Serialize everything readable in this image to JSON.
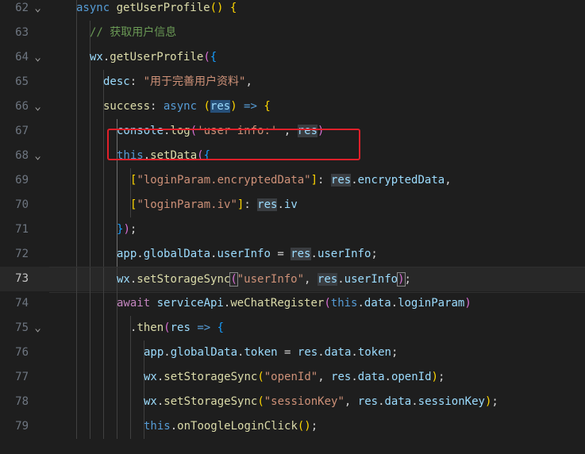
{
  "editor": {
    "lines": [
      {
        "num": "62",
        "fold": "⌄",
        "current": false,
        "indent": 1,
        "tokens": [
          {
            "t": "async ",
            "c": "kw"
          },
          {
            "t": "getUserProfile",
            "c": "fn"
          },
          {
            "t": "() ",
            "c": "br1"
          },
          {
            "t": "{",
            "c": "br1"
          }
        ]
      },
      {
        "num": "63",
        "fold": "",
        "current": false,
        "indent": 2,
        "tokens": [
          {
            "t": "// 获取用户信息",
            "c": "cmt"
          }
        ]
      },
      {
        "num": "64",
        "fold": "⌄",
        "current": false,
        "indent": 2,
        "tokens": [
          {
            "t": "wx",
            "c": "var"
          },
          {
            "t": ".",
            "c": "plain"
          },
          {
            "t": "getUserProfile",
            "c": "fn"
          },
          {
            "t": "(",
            "c": "br2"
          },
          {
            "t": "{",
            "c": "br3"
          }
        ]
      },
      {
        "num": "65",
        "fold": "",
        "current": false,
        "indent": 3,
        "tokens": [
          {
            "t": "desc",
            "c": "var"
          },
          {
            "t": ": ",
            "c": "plain"
          },
          {
            "t": "\"用于完善用户资料\"",
            "c": "str"
          },
          {
            "t": ",",
            "c": "plain"
          }
        ]
      },
      {
        "num": "66",
        "fold": "⌄",
        "current": false,
        "indent": 3,
        "tokens": [
          {
            "t": "success",
            "c": "fn"
          },
          {
            "t": ": ",
            "c": "plain"
          },
          {
            "t": "async ",
            "c": "kw"
          },
          {
            "t": "(",
            "c": "br1"
          },
          {
            "t": "res",
            "c": "var",
            "hl": "hl-dark"
          },
          {
            "t": ")",
            "c": "br1"
          },
          {
            "t": " => ",
            "c": "kw"
          },
          {
            "t": "{",
            "c": "br1"
          }
        ]
      },
      {
        "num": "67",
        "fold": "",
        "current": false,
        "indent": 4,
        "tokens": [
          {
            "t": "console",
            "c": "var"
          },
          {
            "t": ".",
            "c": "plain"
          },
          {
            "t": "log",
            "c": "fn"
          },
          {
            "t": "(",
            "c": "br2"
          },
          {
            "t": "'user info:'",
            "c": "str"
          },
          {
            "t": " , ",
            "c": "plain"
          },
          {
            "t": "res",
            "c": "var",
            "hl": "hl"
          },
          {
            "t": ")",
            "c": "br2"
          }
        ]
      },
      {
        "num": "68",
        "fold": "⌄",
        "current": false,
        "indent": 4,
        "tokens": [
          {
            "t": "this",
            "c": "kw"
          },
          {
            "t": ".",
            "c": "plain"
          },
          {
            "t": "setData",
            "c": "fn"
          },
          {
            "t": "(",
            "c": "br2"
          },
          {
            "t": "{",
            "c": "br3"
          }
        ]
      },
      {
        "num": "69",
        "fold": "",
        "current": false,
        "indent": 5,
        "tokens": [
          {
            "t": "[",
            "c": "br1"
          },
          {
            "t": "\"loginParam.encryptedData\"",
            "c": "str"
          },
          {
            "t": "]",
            "c": "br1"
          },
          {
            "t": ": ",
            "c": "plain"
          },
          {
            "t": "res",
            "c": "var",
            "hl": "hl"
          },
          {
            "t": ".",
            "c": "plain"
          },
          {
            "t": "encryptedData",
            "c": "var"
          },
          {
            "t": ",",
            "c": "plain"
          }
        ]
      },
      {
        "num": "70",
        "fold": "",
        "current": false,
        "indent": 5,
        "tokens": [
          {
            "t": "[",
            "c": "br1"
          },
          {
            "t": "\"loginParam.iv\"",
            "c": "str"
          },
          {
            "t": "]",
            "c": "br1"
          },
          {
            "t": ": ",
            "c": "plain"
          },
          {
            "t": "res",
            "c": "var",
            "hl": "hl"
          },
          {
            "t": ".",
            "c": "plain"
          },
          {
            "t": "iv",
            "c": "var"
          }
        ]
      },
      {
        "num": "71",
        "fold": "",
        "current": false,
        "indent": 4,
        "tokens": [
          {
            "t": "}",
            "c": "br3"
          },
          {
            "t": ")",
            "c": "br2"
          },
          {
            "t": ";",
            "c": "plain"
          }
        ]
      },
      {
        "num": "72",
        "fold": "",
        "current": false,
        "indent": 4,
        "tokens": [
          {
            "t": "app",
            "c": "var"
          },
          {
            "t": ".",
            "c": "plain"
          },
          {
            "t": "globalData",
            "c": "var"
          },
          {
            "t": ".",
            "c": "plain"
          },
          {
            "t": "userInfo",
            "c": "var"
          },
          {
            "t": " = ",
            "c": "plain"
          },
          {
            "t": "res",
            "c": "var",
            "hl": "hl"
          },
          {
            "t": ".",
            "c": "plain"
          },
          {
            "t": "userInfo",
            "c": "var"
          },
          {
            "t": ";",
            "c": "plain"
          }
        ]
      },
      {
        "num": "73",
        "fold": "",
        "current": true,
        "indent": 4,
        "tokens": [
          {
            "t": "wx",
            "c": "var"
          },
          {
            "t": ".",
            "c": "plain"
          },
          {
            "t": "setStorageSync",
            "c": "fn"
          },
          {
            "t": "(",
            "c": "br2",
            "hl": "box-br"
          },
          {
            "t": "\"userInfo\"",
            "c": "str"
          },
          {
            "t": ", ",
            "c": "plain"
          },
          {
            "t": "res",
            "c": "var",
            "hl": "hl"
          },
          {
            "t": ".",
            "c": "plain"
          },
          {
            "t": "userInfo",
            "c": "var"
          },
          {
            "t": ")",
            "c": "br2",
            "hl": "box-br"
          },
          {
            "t": ";",
            "c": "plain"
          }
        ]
      },
      {
        "num": "74",
        "fold": "",
        "current": false,
        "indent": 4,
        "tokens": [
          {
            "t": "await ",
            "c": "ctl"
          },
          {
            "t": "serviceApi",
            "c": "var"
          },
          {
            "t": ".",
            "c": "plain"
          },
          {
            "t": "weChatRegister",
            "c": "fn"
          },
          {
            "t": "(",
            "c": "br2"
          },
          {
            "t": "this",
            "c": "kw"
          },
          {
            "t": ".",
            "c": "plain"
          },
          {
            "t": "data",
            "c": "var"
          },
          {
            "t": ".",
            "c": "plain"
          },
          {
            "t": "loginParam",
            "c": "var"
          },
          {
            "t": ")",
            "c": "br2"
          }
        ]
      },
      {
        "num": "75",
        "fold": "⌄",
        "current": false,
        "indent": 5,
        "tokens": [
          {
            "t": ".",
            "c": "plain"
          },
          {
            "t": "then",
            "c": "fn"
          },
          {
            "t": "(",
            "c": "br2"
          },
          {
            "t": "res",
            "c": "var"
          },
          {
            "t": " => ",
            "c": "kw"
          },
          {
            "t": "{",
            "c": "br3"
          }
        ]
      },
      {
        "num": "76",
        "fold": "",
        "current": false,
        "indent": 6,
        "tokens": [
          {
            "t": "app",
            "c": "var"
          },
          {
            "t": ".",
            "c": "plain"
          },
          {
            "t": "globalData",
            "c": "var"
          },
          {
            "t": ".",
            "c": "plain"
          },
          {
            "t": "token",
            "c": "var"
          },
          {
            "t": " = ",
            "c": "plain"
          },
          {
            "t": "res",
            "c": "var"
          },
          {
            "t": ".",
            "c": "plain"
          },
          {
            "t": "data",
            "c": "var"
          },
          {
            "t": ".",
            "c": "plain"
          },
          {
            "t": "token",
            "c": "var"
          },
          {
            "t": ";",
            "c": "plain"
          }
        ]
      },
      {
        "num": "77",
        "fold": "",
        "current": false,
        "indent": 6,
        "tokens": [
          {
            "t": "wx",
            "c": "var"
          },
          {
            "t": ".",
            "c": "plain"
          },
          {
            "t": "setStorageSync",
            "c": "fn"
          },
          {
            "t": "(",
            "c": "br1"
          },
          {
            "t": "\"openId\"",
            "c": "str"
          },
          {
            "t": ", ",
            "c": "plain"
          },
          {
            "t": "res",
            "c": "var"
          },
          {
            "t": ".",
            "c": "plain"
          },
          {
            "t": "data",
            "c": "var"
          },
          {
            "t": ".",
            "c": "plain"
          },
          {
            "t": "openId",
            "c": "var"
          },
          {
            "t": ")",
            "c": "br1"
          },
          {
            "t": ";",
            "c": "plain"
          }
        ]
      },
      {
        "num": "78",
        "fold": "",
        "current": false,
        "indent": 6,
        "tokens": [
          {
            "t": "wx",
            "c": "var"
          },
          {
            "t": ".",
            "c": "plain"
          },
          {
            "t": "setStorageSync",
            "c": "fn"
          },
          {
            "t": "(",
            "c": "br1"
          },
          {
            "t": "\"sessionKey\"",
            "c": "str"
          },
          {
            "t": ", ",
            "c": "plain"
          },
          {
            "t": "res",
            "c": "var"
          },
          {
            "t": ".",
            "c": "plain"
          },
          {
            "t": "data",
            "c": "var"
          },
          {
            "t": ".",
            "c": "plain"
          },
          {
            "t": "sessionKey",
            "c": "var"
          },
          {
            "t": ")",
            "c": "br1"
          },
          {
            "t": ";",
            "c": "plain"
          }
        ]
      },
      {
        "num": "79",
        "fold": "",
        "current": false,
        "indent": 6,
        "tokens": [
          {
            "t": "this",
            "c": "kw"
          },
          {
            "t": ".",
            "c": "plain"
          },
          {
            "t": "onToogleLoginClick",
            "c": "fn"
          },
          {
            "t": "()",
            "c": "br1"
          },
          {
            "t": ";",
            "c": "plain"
          }
        ]
      }
    ]
  }
}
